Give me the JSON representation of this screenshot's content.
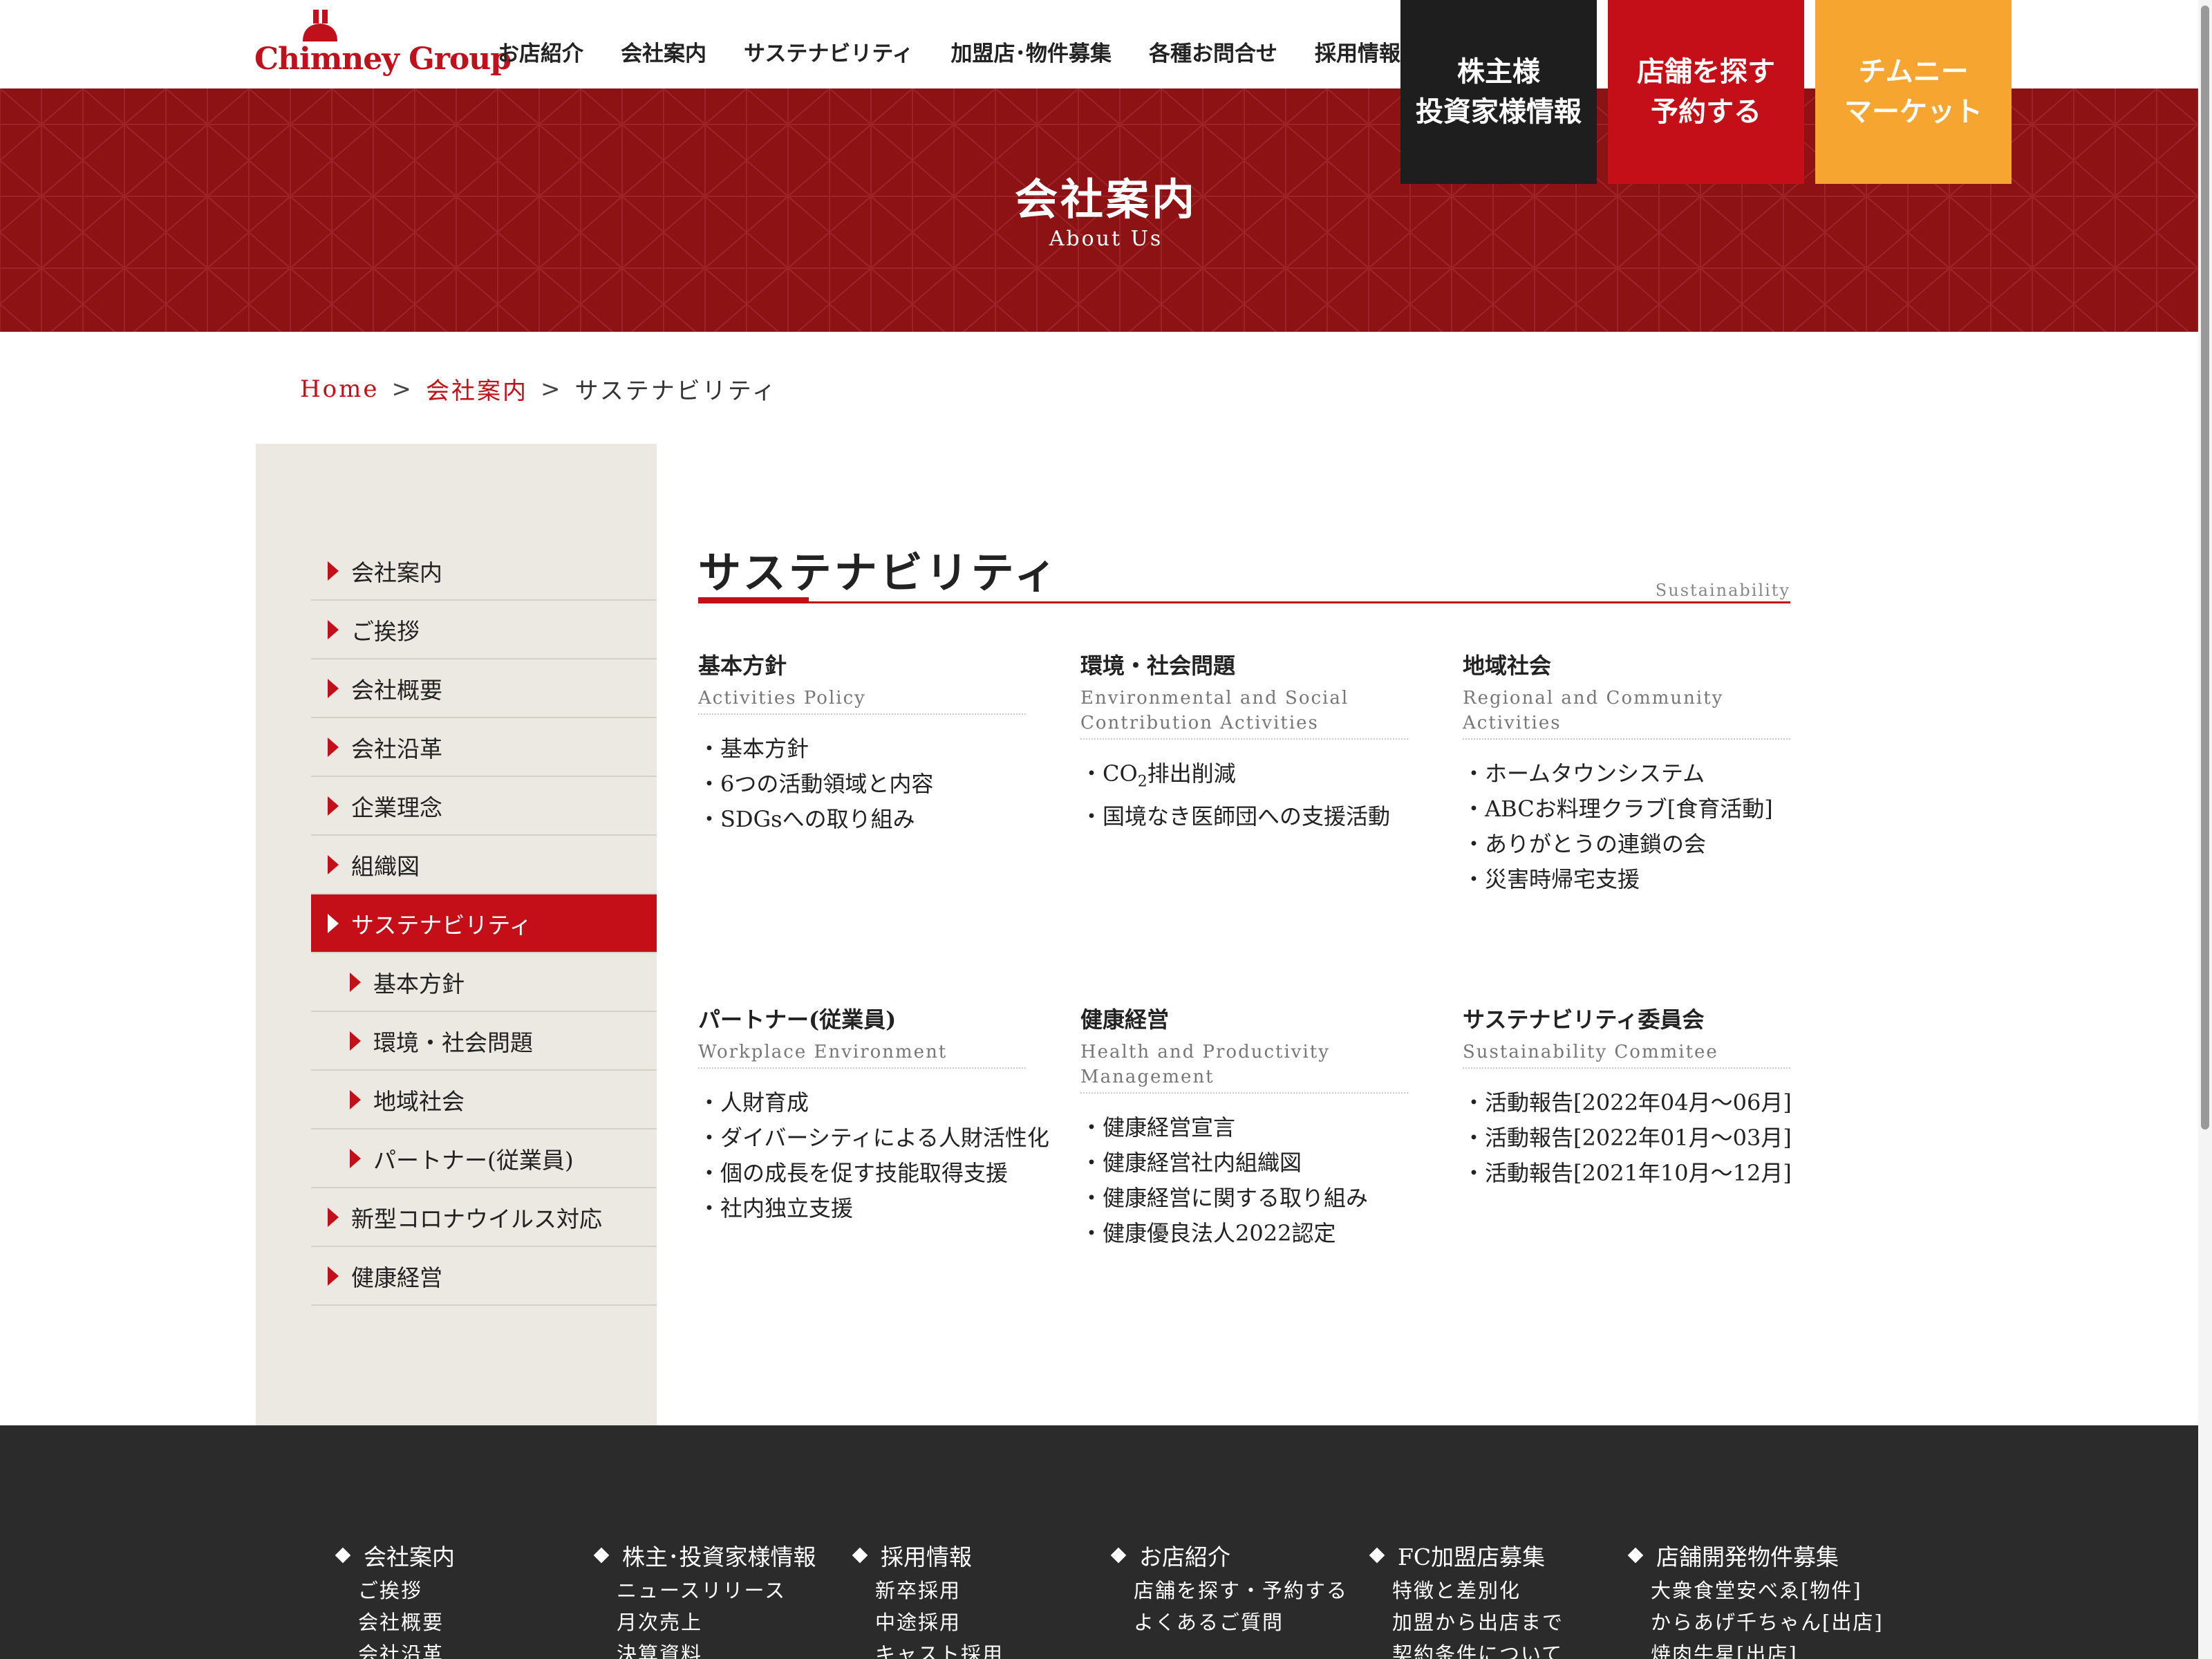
{
  "header": {
    "logo_text": "Chimney Group",
    "nav": [
      "お店紹介",
      "会社案内",
      "サステナビリティ",
      "加盟店･物件募集",
      "各種お問合せ",
      "採用情報"
    ],
    "cta_ir": "株主様\n投資家様情報",
    "cta_shop": "店舗を探す\n予約する",
    "cta_market": "チムニー\nマーケット"
  },
  "hero": {
    "title": "会社案内",
    "subtitle": "About Us"
  },
  "breadcrumb": {
    "home": "Home",
    "sep": ">",
    "parent": "会社案内",
    "current": "サステナビリティ"
  },
  "sidebar": {
    "items": [
      {
        "label": "会社案内"
      },
      {
        "label": "ご挨拶"
      },
      {
        "label": "会社概要"
      },
      {
        "label": "会社沿革"
      },
      {
        "label": "企業理念"
      },
      {
        "label": "組織図"
      },
      {
        "label": "サステナビリティ"
      },
      {
        "label": "基本方針"
      },
      {
        "label": "環境・社会問題"
      },
      {
        "label": "地域社会"
      },
      {
        "label": "パートナー(従業員)"
      },
      {
        "label": "新型コロナウイルス対応"
      },
      {
        "label": "健康経営"
      }
    ]
  },
  "main": {
    "title": "サステナビリティ",
    "title_en": "Sustainability",
    "cards": [
      {
        "title": "基本方針",
        "en": "Activities Policy",
        "items": [
          "・基本方針",
          "・6つの活動領域と内容",
          "・SDGsへの取り組み"
        ]
      },
      {
        "title": "環境・社会問題",
        "en": "Environmental and Social Contribution Activities",
        "items": [
          "・CO",
          "2",
          "排出削減",
          "・国境なき医師団への支援活動"
        ]
      },
      {
        "title": "地域社会",
        "en": "Regional and Community Activities",
        "items": [
          "・ホームタウンシステム",
          "・ABCお料理クラブ[食育活動]",
          "・ありがとうの連鎖の会",
          "・災害時帰宅支援"
        ]
      },
      {
        "title": "パートナー(従業員)",
        "en": "Workplace Environment",
        "items": [
          "・人財育成",
          "・ダイバーシティによる人財活性化",
          "・個の成長を促す技能取得支援",
          "・社内独立支援"
        ]
      },
      {
        "title": "健康経営",
        "en": "Health and Productivity Management",
        "items": [
          "・健康経営宣言",
          "・健康経営社内組織図",
          "・健康経営に関する取り組み",
          "・健康優良法人2022認定"
        ]
      },
      {
        "title": "サステナビリティ委員会",
        "en": "Sustainability Commitee",
        "items": [
          "・活動報告[2022年04月～06月]",
          "・活動報告[2022年01月～03月]",
          "・活動報告[2021年10月～12月]"
        ]
      }
    ]
  },
  "footer": {
    "columns": [
      {
        "head": "会社案内",
        "items": [
          "ご挨拶",
          "会社概要",
          "会社沿革"
        ]
      },
      {
        "head": "株主･投資家様情報",
        "items": [
          "ニュースリリース",
          "月次売上",
          "決算資料"
        ]
      },
      {
        "head": "採用情報",
        "items": [
          "新卒採用",
          "中途採用",
          "キャスト採用"
        ]
      },
      {
        "head": "お店紹介",
        "items": [
          "店舗を探す・予約する",
          "よくあるご質問"
        ]
      },
      {
        "head": "FC加盟店募集",
        "items": [
          "特徴と差別化",
          "加盟から出店まで",
          "契約条件について"
        ]
      },
      {
        "head": "店舗開発物件募集",
        "items": [
          "大衆食堂安べゑ[物件]",
          "からあげ千ちゃん[出店]",
          "焼肉牛星[出店]"
        ]
      }
    ]
  },
  "colors": {
    "brand_red": "#c40f18",
    "hero_red": "#8c1214",
    "ir_black": "#1e1e1e",
    "market_orange": "#f6a531",
    "sidebar_bg": "#ebe9e1",
    "footer_bg": "#2b2b2b"
  }
}
